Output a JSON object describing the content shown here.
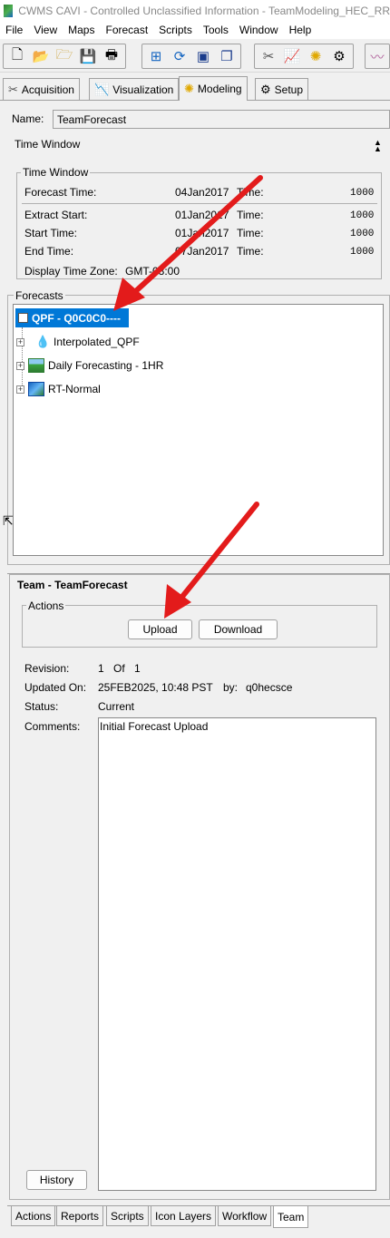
{
  "window": {
    "title": "CWMS CAVI - Controlled Unclassified Information - TeamModeling_HEC_RR"
  },
  "menu": [
    "File",
    "View",
    "Maps",
    "Forecast",
    "Scripts",
    "Tools",
    "Window",
    "Help"
  ],
  "toolbar": {
    "icons": [
      "new-icon",
      "open-icon",
      "open-folder-icon",
      "save-icon",
      "print-icon",
      "network-icon",
      "sync-icon",
      "layout-icon",
      "stack-icon",
      "antenna-icon",
      "chart-icon",
      "sun-icon",
      "gear-icon",
      "graph-icon"
    ]
  },
  "tabs": [
    {
      "label": "Acquisition",
      "icon": "acquisition-icon"
    },
    {
      "label": "Visualization",
      "icon": "visualization-icon"
    },
    {
      "label": "Modeling",
      "icon": "modeling-icon",
      "active": true
    },
    {
      "label": "Setup",
      "icon": "setup-icon"
    }
  ],
  "name": {
    "label": "Name:",
    "value": "TeamForecast"
  },
  "time_window": {
    "header": "Time Window",
    "group_title": "Time Window",
    "rows": [
      {
        "label": "Forecast Time:",
        "date": "04Jan2017",
        "time_label": "Time:",
        "time": "1000"
      },
      {
        "label": "Extract Start:",
        "date": "01Jan2017",
        "time_label": "Time:",
        "time": "1000"
      },
      {
        "label": "Start Time:",
        "date": "01Jan2017",
        "time_label": "Time:",
        "time": "1000"
      },
      {
        "label": "End Time:",
        "date": "07Jan2017",
        "time_label": "Time:",
        "time": "1000"
      }
    ],
    "display_tz_label": "Display Time Zone:",
    "display_tz_value": "GMT-08:00"
  },
  "forecasts": {
    "title": "Forecasts",
    "root": "QPF - Q0C0C0----",
    "children": [
      {
        "label": "Interpolated_QPF",
        "icon": "water-drop-icon"
      },
      {
        "label": "Daily Forecasting - 1HR",
        "icon": "landscape-icon"
      },
      {
        "label": "RT-Normal",
        "icon": "rt-icon"
      }
    ]
  },
  "team": {
    "title": "Team - TeamForecast",
    "actions_title": "Actions",
    "upload": "Upload",
    "download": "Download",
    "revision_label": "Revision:",
    "revision_value": "1",
    "revision_of": "Of",
    "revision_total": "1",
    "updated_label": "Updated On:",
    "updated_value": "25FEB2025, 10:48 PST",
    "by_label": "by:",
    "by_value": "q0hecsce",
    "status_label": "Status:",
    "status_value": "Current",
    "comments_label": "Comments:",
    "comments_value": "Initial Forecast Upload",
    "history": "History"
  },
  "bottom_tabs": [
    "Actions",
    "Reports",
    "Scripts",
    "Icon Layers",
    "Workflow",
    "Team"
  ],
  "annotation_color": "#e31b1b",
  "selection_color": "#0078d7"
}
